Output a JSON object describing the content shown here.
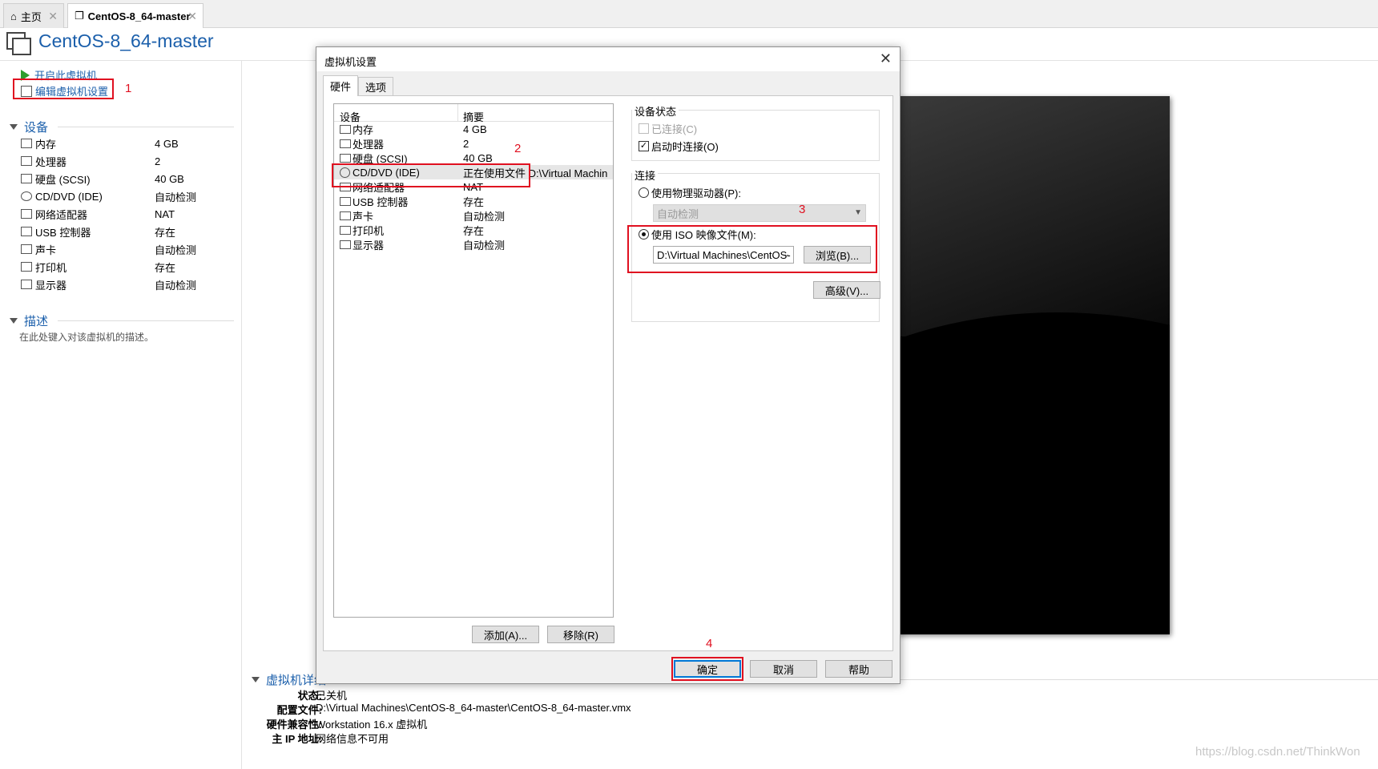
{
  "tabs": [
    {
      "label": "主页",
      "icon": "home-icon"
    },
    {
      "label": "CentOS-8_64-master",
      "icon": "vm-icon"
    }
  ],
  "header": {
    "title": "CentOS-8_64-master"
  },
  "actions": {
    "power_on": "开启此虚拟机",
    "edit_settings": "编辑虚拟机设置"
  },
  "annotations": {
    "n1": "1",
    "n2": "2",
    "n3": "3",
    "n4": "4"
  },
  "devices_section": {
    "title": "设备",
    "items": [
      {
        "name": "内存",
        "value": "4 GB"
      },
      {
        "name": "处理器",
        "value": "2"
      },
      {
        "name": "硬盘 (SCSI)",
        "value": "40 GB"
      },
      {
        "name": "CD/DVD (IDE)",
        "value": "自动检测"
      },
      {
        "name": "网络适配器",
        "value": "NAT"
      },
      {
        "name": "USB 控制器",
        "value": "存在"
      },
      {
        "name": "声卡",
        "value": "自动检测"
      },
      {
        "name": "打印机",
        "value": "存在"
      },
      {
        "name": "显示器",
        "value": "自动检测"
      }
    ]
  },
  "description_section": {
    "title": "描述",
    "placeholder": "在此处键入对该虚拟机的描述。"
  },
  "details_section": {
    "title": "虚拟机详细",
    "rows": [
      {
        "key": "状态:",
        "value": "已关机"
      },
      {
        "key": "配置文件:",
        "value": "D:\\Virtual Machines\\CentOS-8_64-master\\CentOS-8_64-master.vmx"
      },
      {
        "key": "硬件兼容性:",
        "value": "Workstation 16.x 虚拟机"
      },
      {
        "key": "主 IP 地址:",
        "value": "网络信息不可用"
      }
    ]
  },
  "watermark": "https://blog.csdn.net/ThinkWon",
  "dialog": {
    "title": "虚拟机设置",
    "close": "✕",
    "tabs": [
      "硬件",
      "选项"
    ],
    "device_list": {
      "col_device": "设备",
      "col_summary": "摘要",
      "rows": [
        {
          "name": "内存",
          "value": "4 GB"
        },
        {
          "name": "处理器",
          "value": "2"
        },
        {
          "name": "硬盘 (SCSI)",
          "value": "40 GB"
        },
        {
          "name": "CD/DVD (IDE)",
          "value": "正在使用文件 D:\\Virtual Machin..."
        },
        {
          "name": "网络适配器",
          "value": "NAT"
        },
        {
          "name": "USB 控制器",
          "value": "存在"
        },
        {
          "name": "声卡",
          "value": "自动检测"
        },
        {
          "name": "打印机",
          "value": "存在"
        },
        {
          "name": "显示器",
          "value": "自动检测"
        }
      ],
      "selected_index": 3
    },
    "add_button": "添加(A)...",
    "remove_button": "移除(R)",
    "device_status": {
      "title": "设备状态",
      "connected": "已连接(C)",
      "connect_on_power": "启动时连接(O)"
    },
    "connection": {
      "title": "连接",
      "physical": "使用物理驱动器(P):",
      "physical_value": "自动检测",
      "iso": "使用 ISO 映像文件(M):",
      "iso_value": "D:\\Virtual Machines\\CentOS-",
      "browse": "浏览(B)..."
    },
    "advanced": "高级(V)...",
    "ok": "确定",
    "cancel": "取消",
    "help": "帮助"
  }
}
